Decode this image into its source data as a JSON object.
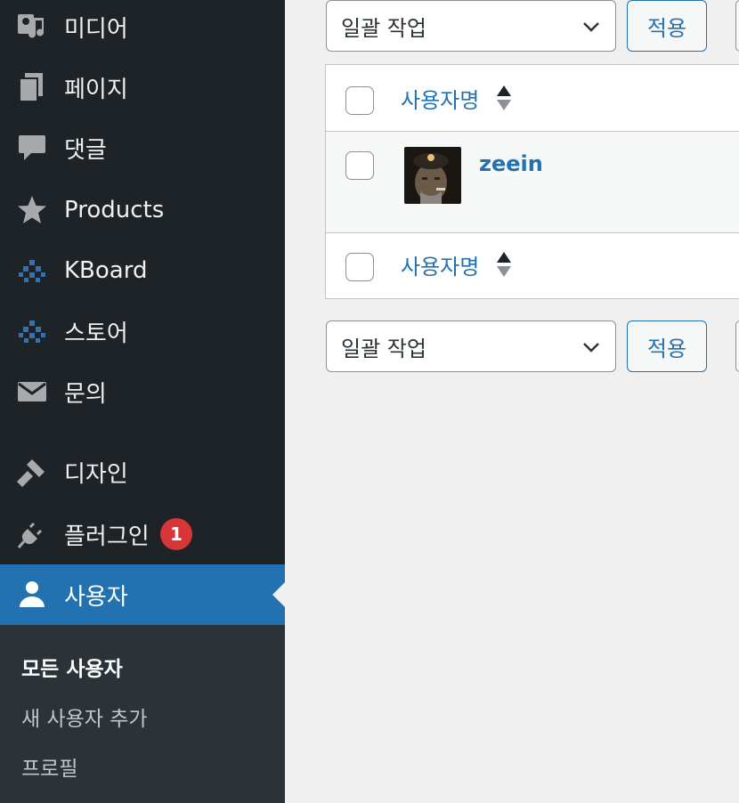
{
  "sidebar": {
    "items": [
      {
        "label": "미디어",
        "icon": "media-icon"
      },
      {
        "label": "페이지",
        "icon": "pages-icon"
      },
      {
        "label": "댓글",
        "icon": "comments-icon"
      },
      {
        "label": "Products",
        "icon": "star-icon"
      },
      {
        "label": "KBoard",
        "icon": "kboard-icon"
      },
      {
        "label": "스토어",
        "icon": "store-icon"
      },
      {
        "label": "문의",
        "icon": "mail-icon"
      },
      {
        "label": "디자인",
        "icon": "paintbrush-icon"
      },
      {
        "label": "플러그인",
        "icon": "plugin-icon",
        "badge": "1"
      },
      {
        "label": "사용자",
        "icon": "user-icon",
        "active": true
      }
    ],
    "submenu": [
      {
        "label": "모든 사용자",
        "current": true
      },
      {
        "label": "새 사용자 추가"
      },
      {
        "label": "프로필"
      }
    ]
  },
  "bulk_top": {
    "select_value": "일괄 작업",
    "apply_label": "적용"
  },
  "bulk_bottom": {
    "select_value": "일괄 작업",
    "apply_label": "적용"
  },
  "table": {
    "header_username": "사용자명",
    "footer_username": "사용자명",
    "rows": [
      {
        "username": "zeein"
      }
    ]
  },
  "colors": {
    "sidebar_bg": "#1d2327",
    "submenu_bg": "#2c3338",
    "accent": "#2271b1",
    "badge": "#d63638"
  }
}
